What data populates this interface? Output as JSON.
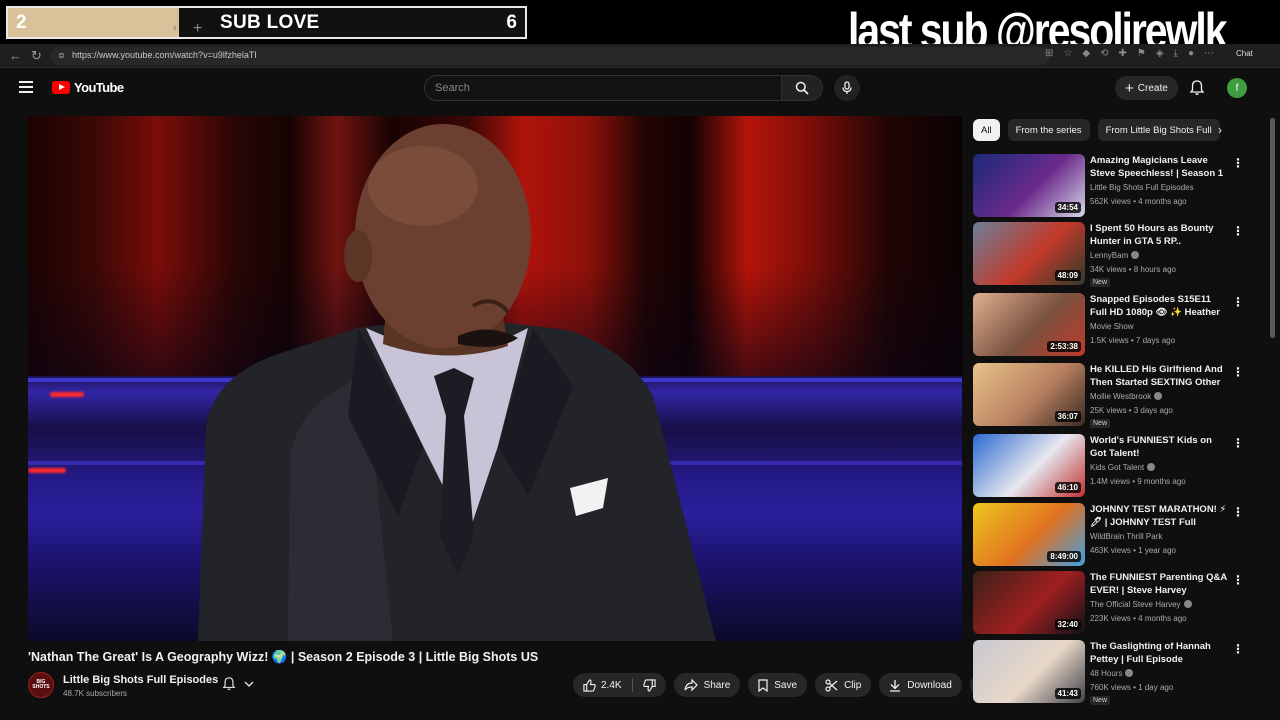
{
  "overlay": {
    "sub_goal_current": "2",
    "sub_goal_label": "SUB LOVE",
    "sub_goal_target": "6",
    "sub_goal_progress": 0.33,
    "last_sub_text": "last sub @resoljrewlk"
  },
  "browser": {
    "url": "https://www.youtube.com/watch?v=u9lfzhelaTI",
    "chat_label": "Chat"
  },
  "header": {
    "logo_text": "YouTube",
    "search_placeholder": "Search",
    "create_label": "Create",
    "avatar_letter": "f"
  },
  "video": {
    "title": "'Nathan The Great' Is A Geography Wizz! 🌍 | Season 2 Episode 3 | Little Big Shots US",
    "channel_name": "Little Big Shots Full Episodes",
    "channel_subs": "48.7K subscribers",
    "channel_avatar_text": "BIG SHOTS",
    "like_count": "2.4K",
    "share_label": "Share",
    "save_label": "Save",
    "clip_label": "Clip",
    "download_label": "Download"
  },
  "sidebar": {
    "chips": [
      "All",
      "From the series",
      "From Little Big Shots Full"
    ],
    "recommendations": [
      {
        "title": "Amazing Magicians Leave Steve Speechless! | Season 1 ...",
        "channel": "Little Big Shots Full Episodes",
        "verified": false,
        "meta": "562K views • 4 months ago",
        "duration": "34:54",
        "badge": "",
        "colors": [
          "#1b2a7a",
          "#6b2b8c",
          "#d8d8e8"
        ]
      },
      {
        "title": "I Spent 50 Hours as Bounty Hunter in GTA 5 RP..",
        "channel": "LennyBam",
        "verified": true,
        "meta": "34K views • 8 hours ago",
        "duration": "48:09",
        "badge": "New",
        "colors": [
          "#6a7f9a",
          "#c33a2a",
          "#2e3b2a"
        ]
      },
      {
        "title": "Snapped Episodes S15E11 Full HD 1080p 👁 ✨ Heather Hors...",
        "channel": "Movie Show",
        "verified": false,
        "meta": "1.5K views • 7 days ago",
        "duration": "2:53:38",
        "badge": "",
        "colors": [
          "#e0b090",
          "#7a5240",
          "#c0392b"
        ]
      },
      {
        "title": "He KILLED His Girlfriend And Then Started SEXTING Other ...",
        "channel": "Mollie Westbrook",
        "verified": true,
        "meta": "25K views • 3 days ago",
        "duration": "36:07",
        "badge": "New",
        "colors": [
          "#e8c48a",
          "#b88060",
          "#3a2a22"
        ]
      },
      {
        "title": "World's FUNNIEST Kids on Got Talent!",
        "channel": "Kids Got Talent",
        "verified": true,
        "meta": "1.4M views • 9 months ago",
        "duration": "46:10",
        "badge": "",
        "colors": [
          "#2a6ad0",
          "#e8e8f0",
          "#c03030"
        ]
      },
      {
        "title": "JOHNNY TEST MARATHON! ⚡🖊 | JOHNNY TEST Full Episo...",
        "channel": "WildBrain Thrill Park",
        "verified": false,
        "meta": "463K views • 1 year ago",
        "duration": "8:49:00",
        "badge": "",
        "colors": [
          "#f0c820",
          "#e07020",
          "#40a0e0"
        ]
      },
      {
        "title": "The FUNNIEST Parenting Q&A EVER! | Steve Harvey",
        "channel": "The Official Steve Harvey",
        "verified": true,
        "meta": "223K views • 4 months ago",
        "duration": "32:40",
        "badge": "",
        "colors": [
          "#3a2018",
          "#a02020",
          "#101018"
        ]
      },
      {
        "title": "The Gaslighting of Hannah Pettey | Full Episode",
        "channel": "48 Hours",
        "verified": true,
        "meta": "760K views • 1 day ago",
        "duration": "41:43",
        "badge": "New",
        "colors": [
          "#c8c8d0",
          "#e8d8c8",
          "#404048"
        ]
      }
    ]
  },
  "icons": {
    "hamburger": "menu-icon",
    "search": "search-icon",
    "mic": "mic-icon",
    "bell": "bell-icon",
    "like": "thumbs-up-icon",
    "dislike": "thumbs-down-icon",
    "share": "share-icon",
    "save": "bookmark-icon",
    "clip": "scissors-icon",
    "download": "download-icon"
  }
}
